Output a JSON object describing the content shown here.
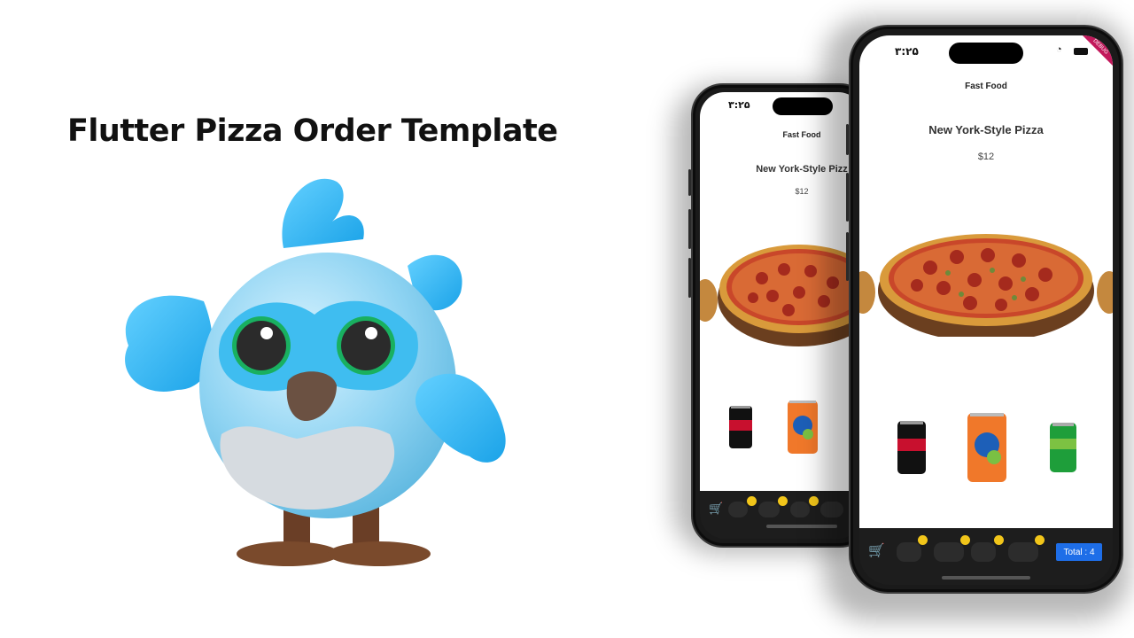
{
  "heading": "Flutter Pizza Order Template",
  "app": {
    "status_time": "۳:۲۵",
    "title": "Fast Food",
    "pizza_name": "New York-Style Pizza",
    "back_pizza_name": "New York-Style Pizz",
    "price": "$12",
    "total_label": "Total : 4"
  },
  "drinks": [
    "coca-cola-can",
    "fanta-orange-can",
    "sprite-can"
  ],
  "colors": {
    "accent": "#1e6ee8",
    "badge": "#f2c61a",
    "bird_body": "#8fd6f6",
    "bird_wing": "#2fb5f0"
  },
  "icons": [
    "cart-icon",
    "coke-thumb-icon",
    "pizza-thumb-icon",
    "sprite-thumb-icon"
  ]
}
